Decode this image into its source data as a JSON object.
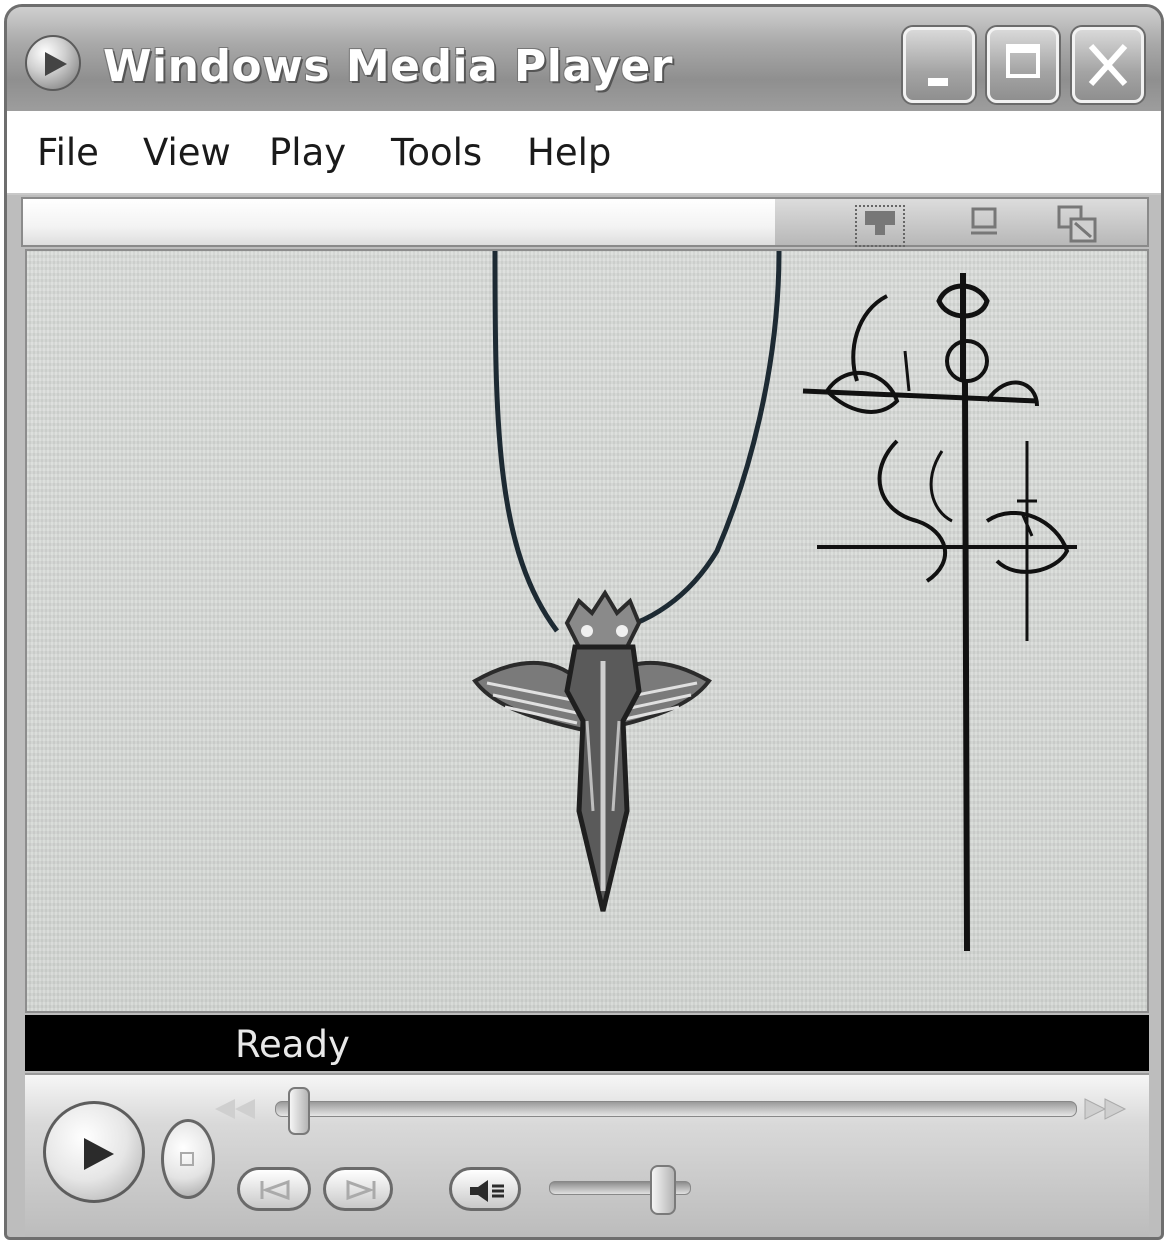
{
  "window": {
    "title": "Windows Media Player",
    "icon": "media-player-icon"
  },
  "titlebar_buttons": {
    "minimize_icon": "minimize-icon",
    "maximize_icon": "maximize-icon",
    "close_icon": "close-icon"
  },
  "menu": {
    "items": [
      "File",
      "View",
      "Play",
      "Tools",
      "Help"
    ]
  },
  "toolbar": {
    "icons": [
      "select-skin-icon",
      "compact-mode-icon",
      "full-mode-icon"
    ]
  },
  "video": {
    "content": [
      "necklace-pendant-image",
      "gothic-cross-ornament-image"
    ]
  },
  "status": {
    "text": "Ready"
  },
  "controls": {
    "seek_position": 0.03,
    "volume_level": 0.8,
    "icons": [
      "play-icon",
      "stop-icon",
      "previous-track-icon",
      "next-track-icon",
      "mute-icon",
      "rewind-icon",
      "fast-forward-icon"
    ]
  },
  "colors": {
    "title_text": "#ffffff",
    "status_bg": "#000000",
    "status_text": "#e8e8e8",
    "video_bg": "#d6d9d6",
    "menu_bg": "#ffffff"
  }
}
